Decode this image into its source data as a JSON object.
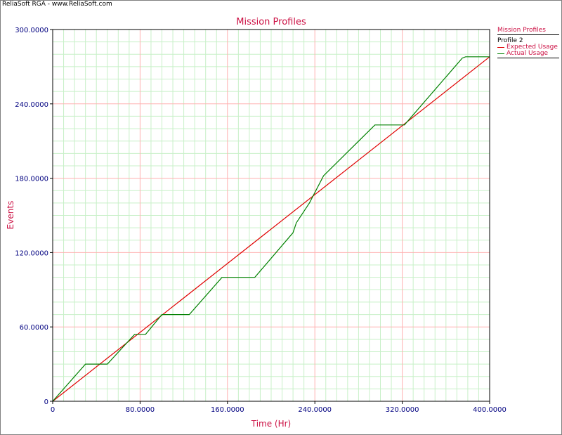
{
  "banner": "ReliaSoft RGA - www.ReliaSoft.com",
  "colors": {
    "title": "#cc1144",
    "axis_label": "#cc1144",
    "tick_label": "#000080",
    "grid_major": "#ffb0b0",
    "grid_minor": "#c8f0c8",
    "expected": "#e00000",
    "actual": "#008000"
  },
  "legend": {
    "title": "Mission Profiles",
    "group": "Profile 2",
    "entries": [
      {
        "label": "Expected Usage",
        "color": "#e00000"
      },
      {
        "label": "Actual Usage",
        "color": "#008000"
      }
    ]
  },
  "chart_data": {
    "type": "line",
    "title": "Mission Profiles",
    "xlabel": "Time (Hr)",
    "ylabel": "Events",
    "xlim": [
      0,
      400
    ],
    "ylim": [
      0,
      300
    ],
    "xticks": [
      "0",
      "80.0000",
      "160.0000",
      "240.0000",
      "320.0000",
      "400.0000"
    ],
    "yticks": [
      "0",
      "60.0000",
      "120.0000",
      "180.0000",
      "240.0000",
      "300.0000"
    ],
    "grid": true,
    "legend_position": "top-right",
    "series": [
      {
        "name": "Expected Usage",
        "x": [
          0,
          400
        ],
        "y": [
          0,
          278
        ]
      },
      {
        "name": "Actual Usage",
        "x": [
          0,
          30,
          50,
          75,
          85,
          100,
          125,
          155,
          185,
          220,
          223,
          235,
          248,
          295,
          322,
          375,
          378,
          400
        ],
        "y": [
          0,
          30,
          30,
          54,
          54,
          70,
          70,
          100,
          100,
          136,
          144,
          160,
          182,
          223,
          223,
          277,
          278,
          278
        ]
      }
    ]
  }
}
